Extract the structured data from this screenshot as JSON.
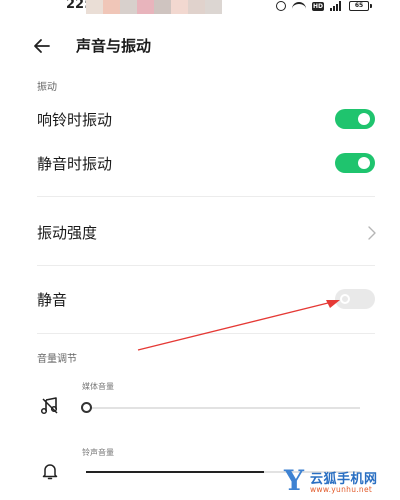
{
  "status_bar": {
    "time": "22:",
    "battery": "65",
    "blur_colors": [
      "#eaded6",
      "#f0c6b8",
      "#d8d0cc",
      "#e8b4bc",
      "#cfc4c0",
      "#f2d8d0",
      "#e0d2cc",
      "#dcd6d2"
    ]
  },
  "header": {
    "title": "声音与振动"
  },
  "vibration": {
    "section_label": "振动",
    "ring_vibrate": {
      "label": "响铃时振动",
      "on": true
    },
    "silent_vibrate": {
      "label": "静音时振动",
      "on": true
    }
  },
  "vibration_intensity": {
    "label": "振动强度"
  },
  "mute": {
    "label": "静音",
    "on": false
  },
  "volume": {
    "section_label": "音量调节",
    "media": {
      "label": "媒体音量",
      "value_percent": 0
    },
    "ringtone": {
      "label": "铃声音量",
      "value_percent": 65
    }
  },
  "watermark": {
    "logo_letter": "Y",
    "brand": "云狐手机网",
    "url": "www.yunhu.net"
  },
  "colors": {
    "toggle_on": "#1fc46e",
    "toggle_off": "#e9e9e9",
    "annotation_arrow": "#e53935"
  }
}
